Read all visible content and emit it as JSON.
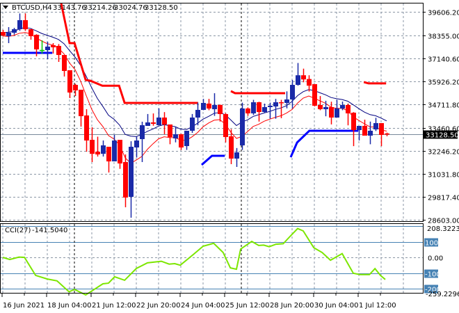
{
  "header": {
    "symbol": "BTCUSD,H4",
    "open": "33143.76",
    "high": "33214.26",
    "low": "33024.76",
    "close": "33128.50"
  },
  "cci_header": {
    "label": "CCI(27)",
    "value": "-141.5040"
  },
  "price_axis": [
    "39606.20",
    "38355.00",
    "37140.60",
    "35926.20",
    "34711.80",
    "33460.60",
    "32246.20",
    "31031.80",
    "29817.40",
    "28603.00"
  ],
  "current_price": "33128.50",
  "cci_axis": {
    "top": "208.3223",
    "bottom": "-259.2296",
    "levels": [
      "100",
      "0.00",
      "-100",
      "-200"
    ]
  },
  "time_axis": [
    "16 Jun 2021",
    "18 Jun 04:00",
    "21 Jun 12:00",
    "22 Jun 20:00",
    "24 Jun 04:00",
    "25 Jun 12:00",
    "28 Jun 20:00",
    "30 Jun 04:00",
    "1 Jul 12:00"
  ],
  "colors": {
    "bull": "#1a2aa8",
    "bear": "#ff0000",
    "doji": "#00c800",
    "ma_slow": "#000080",
    "ma_fast": "#ff0000",
    "resistance": "#ff0000",
    "support": "#0000ff",
    "cci": "#7ce600",
    "levels": "#4682b4"
  },
  "chart_data": {
    "type": "candlestick",
    "title": "BTCUSD,H4",
    "ylim": [
      28603,
      40232
    ],
    "candles": [
      [
        38539,
        38650,
        38300,
        38355
      ],
      [
        38318,
        38797,
        37950,
        38502
      ],
      [
        38502,
        38760,
        38400,
        38686
      ],
      [
        38686,
        39520,
        38600,
        39165
      ],
      [
        39165,
        39520,
        38600,
        38686
      ],
      [
        38686,
        38700,
        38134,
        38318
      ],
      [
        38392,
        38420,
        37251,
        37619
      ],
      [
        37582,
        38098,
        37398,
        37590
      ],
      [
        37582,
        38024,
        37104,
        37766
      ],
      [
        37840,
        37950,
        37400,
        37730
      ],
      [
        37803,
        37900,
        36957,
        37325
      ],
      [
        37325,
        37325,
        36184,
        36478
      ],
      [
        36515,
        36515,
        35043,
        35338
      ],
      [
        35742,
        35800,
        35154,
        35448
      ],
      [
        35485,
        35485,
        33534,
        34086
      ],
      [
        34123,
        34454,
        32206,
        32798
      ],
      [
        32835,
        33498,
        31658,
        32094
      ],
      [
        32206,
        33000,
        31950,
        32062
      ],
      [
        32094,
        32800,
        31950,
        32541
      ],
      [
        32467,
        32467,
        31106,
        31694
      ],
      [
        31694,
        33100,
        31694,
        32798
      ],
      [
        32835,
        32835,
        31300,
        31584
      ],
      [
        31658,
        32062,
        29266,
        29781
      ],
      [
        29818,
        32760,
        28714,
        32467
      ],
      [
        32430,
        33000,
        31900,
        32798
      ],
      [
        32872,
        33792,
        31658,
        33608
      ],
      [
        33571,
        34200,
        33571,
        33755
      ],
      [
        33755,
        34230,
        33580,
        33682
      ],
      [
        33608,
        34500,
        33608,
        34013
      ],
      [
        34013,
        34300,
        33130,
        33645
      ],
      [
        33645,
        33645,
        32600,
        32982
      ],
      [
        32909,
        33500,
        32700,
        33130
      ],
      [
        33130,
        33150,
        32300,
        32430
      ],
      [
        32504,
        33314,
        32300,
        33314
      ],
      [
        33314,
        34200,
        33200,
        34013
      ],
      [
        34013,
        34800,
        33600,
        34418
      ],
      [
        34418,
        35000,
        34400,
        34786
      ],
      [
        34750,
        35000,
        34400,
        34491
      ],
      [
        34454,
        35300,
        34100,
        34680
      ],
      [
        34680,
        34700,
        33800,
        34197
      ],
      [
        34197,
        34250,
        32700,
        32982
      ],
      [
        33019,
        33400,
        31547,
        31842
      ],
      [
        31842,
        32400,
        31400,
        32170
      ],
      [
        32541,
        34800,
        32300,
        34491
      ],
      [
        34491,
        34550,
        34100,
        34234
      ],
      [
        34234,
        34950,
        34150,
        34822
      ],
      [
        34822,
        34850,
        33800,
        34307
      ],
      [
        34307,
        34750,
        34250,
        34565
      ],
      [
        34565,
        34800,
        33950,
        34638
      ],
      [
        34600,
        35000,
        33950,
        34822
      ],
      [
        34822,
        34950,
        33980,
        34786
      ],
      [
        34786,
        35400,
        34500,
        34970
      ],
      [
        34970,
        36000,
        34500,
        35742
      ],
      [
        35742,
        36900,
        35700,
        36250
      ],
      [
        36250,
        36600,
        35880,
        36030
      ],
      [
        36050,
        36250,
        35390,
        35700
      ],
      [
        35780,
        35780,
        34600,
        34638
      ],
      [
        34675,
        35150,
        34400,
        34454
      ],
      [
        34454,
        34900,
        34080,
        34565
      ],
      [
        34565,
        34850,
        33650,
        34013
      ],
      [
        34013,
        34950,
        34013,
        34491
      ],
      [
        34491,
        34860,
        34400,
        34675
      ],
      [
        34675,
        34750,
        33600,
        34234
      ],
      [
        34270,
        34300,
        32500,
        33350
      ],
      [
        33350,
        33571,
        32800,
        33571
      ],
      [
        33571,
        33900,
        33056,
        33056
      ],
      [
        33056,
        33800,
        32600,
        33314
      ],
      [
        33387,
        34000,
        33300,
        33718
      ],
      [
        33718,
        33718,
        32500,
        33093
      ],
      [
        33143.76,
        33214.26,
        33024.76,
        33128.5
      ]
    ],
    "resistance_lines": [
      [
        [
          10.5,
          40300
        ],
        [
          12,
          37950
        ],
        [
          12.9,
          37950
        ],
        [
          14.9,
          36000
        ],
        [
          15.75,
          35960
        ],
        [
          17.9,
          35700
        ],
        [
          20.9,
          35700
        ],
        [
          21.9,
          34786
        ],
        [
          35.1,
          34786
        ]
      ],
      [
        [
          41,
          35410
        ],
        [
          41.75,
          35300
        ],
        [
          50.75,
          35300
        ]
      ],
      [
        [
          64.9,
          35890
        ],
        [
          65.75,
          35820
        ],
        [
          68.9,
          35820
        ]
      ]
    ],
    "support_lines": [
      [
        [
          0,
          37435
        ],
        [
          8.9,
          37435
        ]
      ],
      [
        [
          35.75,
          31510
        ],
        [
          37.6,
          31990
        ],
        [
          39.9,
          31990
        ]
      ],
      [
        [
          51.75,
          31915
        ],
        [
          52.9,
          32690
        ],
        [
          55.1,
          33314
        ],
        [
          63.9,
          33314
        ]
      ]
    ],
    "cci": {
      "period": 27,
      "ylim": [
        -259.2296,
        208.3223
      ],
      "levels": [
        100,
        0,
        -100,
        -200
      ],
      "points": [
        [
          0,
          0
        ],
        [
          1.25,
          -14
        ],
        [
          2.9,
          2
        ],
        [
          3.9,
          0
        ],
        [
          5.9,
          -115
        ],
        [
          8,
          -138
        ],
        [
          9.75,
          -150
        ],
        [
          11.9,
          -220
        ],
        [
          12.9,
          -205
        ],
        [
          14.9,
          -240
        ],
        [
          18,
          -169
        ],
        [
          19,
          -165
        ],
        [
          20.1,
          -124
        ],
        [
          21.9,
          -146
        ],
        [
          24,
          -71
        ],
        [
          26,
          -35
        ],
        [
          28.5,
          -25
        ],
        [
          29.9,
          -43
        ],
        [
          30.9,
          -40
        ],
        [
          31.9,
          -50
        ],
        [
          34.25,
          18
        ],
        [
          36,
          71
        ],
        [
          37.9,
          90
        ],
        [
          39.6,
          31
        ],
        [
          40.9,
          -67
        ],
        [
          42,
          -76
        ],
        [
          42.75,
          53
        ],
        [
          44.75,
          102
        ],
        [
          46,
          76
        ],
        [
          46.9,
          78
        ],
        [
          47.9,
          68
        ],
        [
          49.1,
          84
        ],
        [
          50.4,
          87
        ],
        [
          51.5,
          129
        ],
        [
          53,
          184
        ],
        [
          54,
          169
        ],
        [
          55.9,
          62
        ],
        [
          57.4,
          31
        ],
        [
          58.9,
          -18
        ],
        [
          61,
          24
        ],
        [
          63,
          -102
        ],
        [
          64.25,
          -110
        ],
        [
          65.9,
          -110
        ],
        [
          66.9,
          -72
        ],
        [
          67.9,
          -116
        ],
        [
          68.75,
          -141.504
        ]
      ]
    }
  }
}
